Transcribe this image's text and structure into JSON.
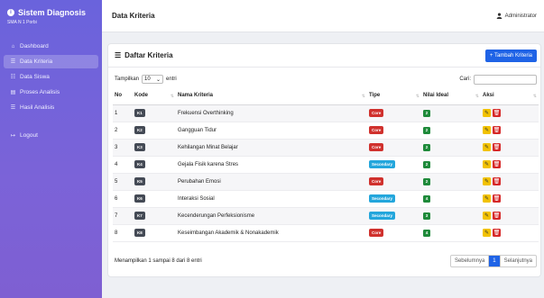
{
  "brand": {
    "icon": "i",
    "title": "Sistem Diagnosis",
    "subtitle": "SMA N 1 Porbi"
  },
  "nav": [
    {
      "label": "Dashboard",
      "icon": "⌂"
    },
    {
      "label": "Data Kriteria",
      "icon": "☰"
    },
    {
      "label": "Data Siswa",
      "icon": "☷"
    },
    {
      "label": "Proses Analisis",
      "icon": "▤"
    },
    {
      "label": "Hasil Analisis",
      "icon": "☰"
    },
    {
      "label": "Logout",
      "icon": "↦"
    }
  ],
  "topbar": {
    "title": "Data Kriteria",
    "user": "Administrator"
  },
  "card": {
    "title": "Daftar Kriteria",
    "add_button": "+ Tambah Kriteria"
  },
  "controls": {
    "show_label": "Tampilkan",
    "length_value": "10",
    "entries_label": "entri",
    "search_label": "Cari:"
  },
  "columns": [
    "No",
    "Kode",
    "Nama Kriteria",
    "Tipe",
    "Nilai Ideal",
    "Aksi"
  ],
  "rows": [
    {
      "no": "1",
      "kode": "K1",
      "nama": "Frekuensi Overthinking",
      "tipe": "Core",
      "nilai": "2"
    },
    {
      "no": "2",
      "kode": "K2",
      "nama": "Gangguan Tidur",
      "tipe": "Core",
      "nilai": "2"
    },
    {
      "no": "3",
      "kode": "K3",
      "nama": "Kehilangan Minat Belajar",
      "tipe": "Core",
      "nilai": "2"
    },
    {
      "no": "4",
      "kode": "K4",
      "nama": "Gejala Fisik karena Stres",
      "tipe": "Secondary",
      "nilai": "2"
    },
    {
      "no": "5",
      "kode": "K5",
      "nama": "Perubahan Emosi",
      "tipe": "Core",
      "nilai": "2"
    },
    {
      "no": "6",
      "kode": "K6",
      "nama": "Interaksi Sosial",
      "tipe": "Secondary",
      "nilai": "4"
    },
    {
      "no": "7",
      "kode": "K7",
      "nama": "Kecenderungan Perfeksionisme",
      "tipe": "Secondary",
      "nilai": "3"
    },
    {
      "no": "8",
      "kode": "K8",
      "nama": "Keseimbangan Akademik & Nonakademik",
      "tipe": "Core",
      "nilai": "4"
    }
  ],
  "footer": {
    "info": "Menampilkan 1 sampai 8 dari 8 entri",
    "prev": "Sebelumnya",
    "page": "1",
    "next": "Selanjutnya"
  },
  "colors": {
    "sidebar": "#6a63dc",
    "primary": "#1f63e6",
    "core": "#d0312d",
    "secondary": "#23a6dc",
    "nilai": "#1e8a3a",
    "edit": "#f2c200",
    "delete": "#d62828"
  }
}
